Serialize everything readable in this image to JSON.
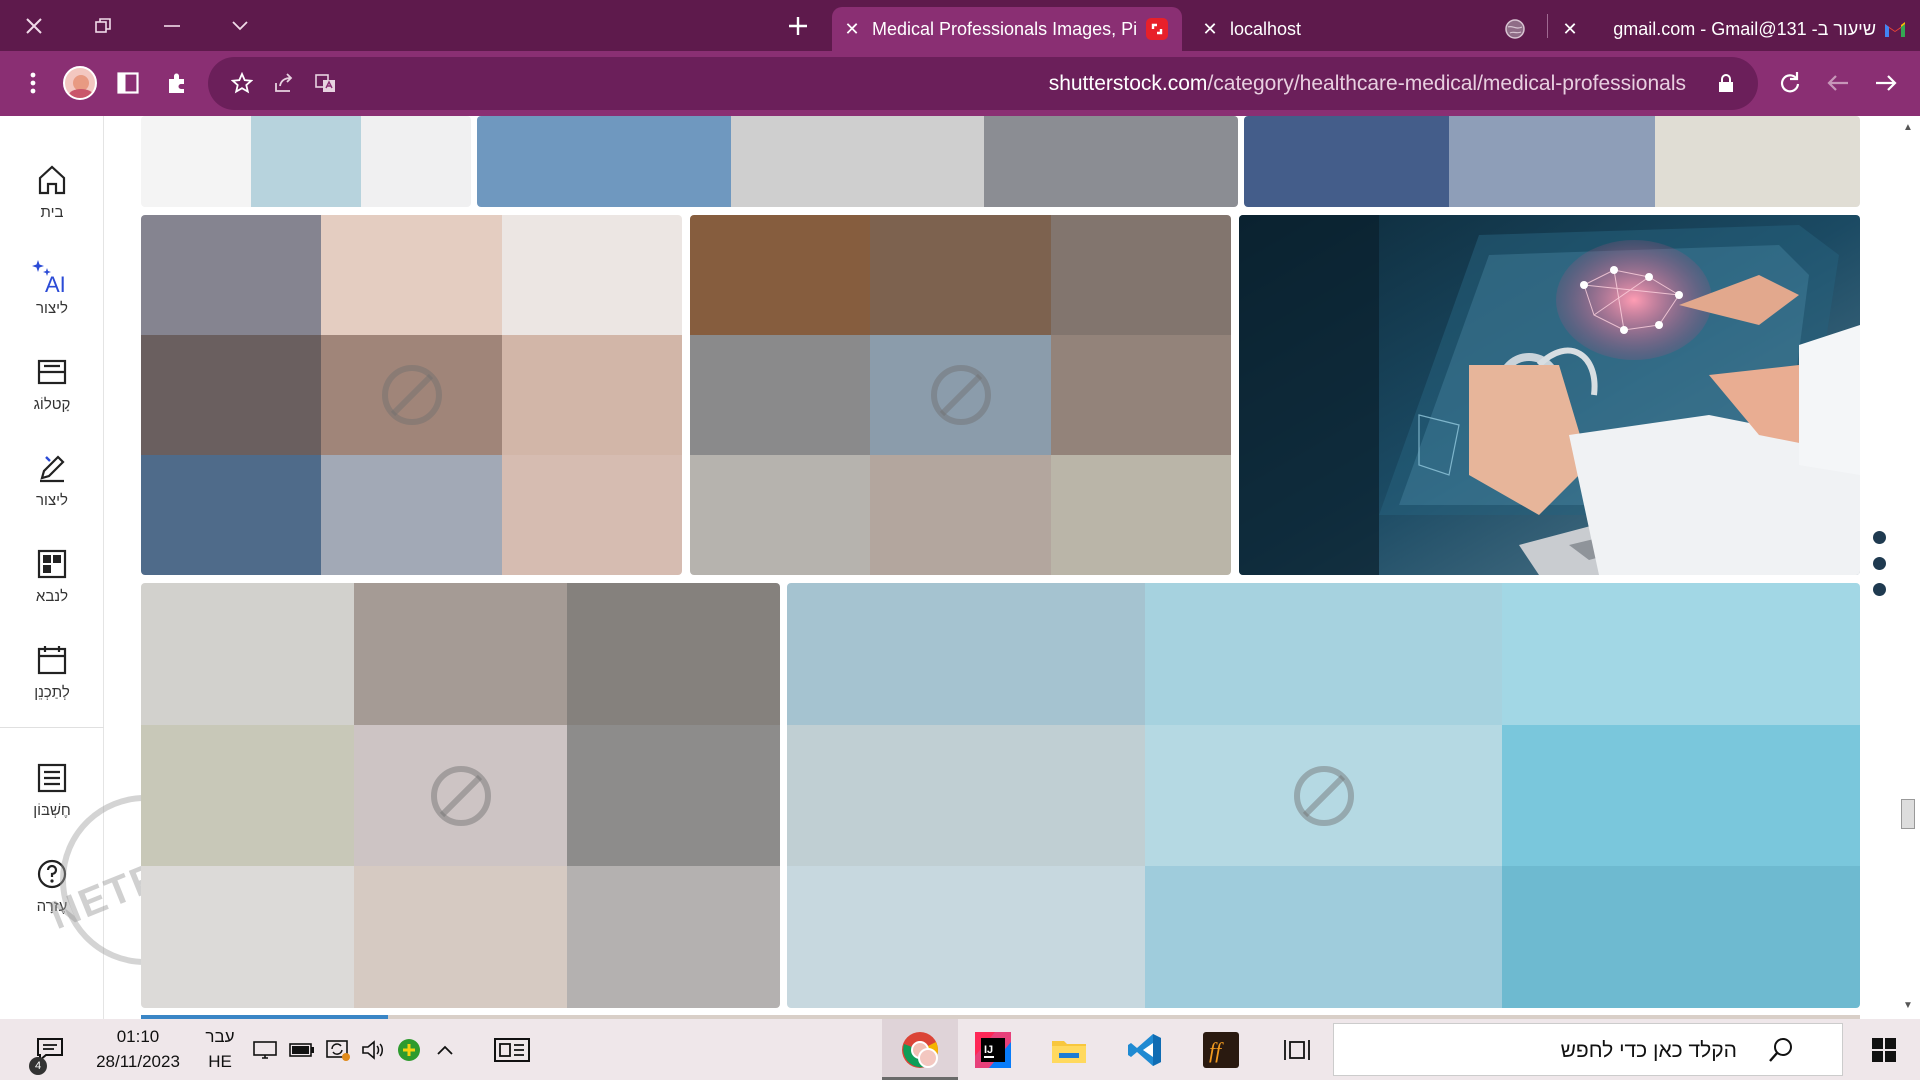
{
  "browser": {
    "tabs": [
      {
        "title": "Medical Professionals Images, Pi",
        "favicon": "shutterstock-icon",
        "active": true
      },
      {
        "title": "localhost",
        "favicon": "globe-icon",
        "active": false
      },
      {
        "title": "שיעור ב- 131@gmail.com - Gmail",
        "favicon": "gmail-icon",
        "active": false
      }
    ],
    "url_domain": "shutterstock.com",
    "url_path": "/category/healthcare-medical/medical-professionals",
    "colors": {
      "titlebar": "#5e1a4c",
      "toolbar": "#8a2f73",
      "active_tab": "#8a2f73"
    }
  },
  "sidenav": {
    "items": [
      {
        "label": "בית",
        "icon": "home-icon"
      },
      {
        "label": "ליצור",
        "icon": "ai-sparkle-icon"
      },
      {
        "label": "קָטלוֹג",
        "icon": "catalog-icon"
      },
      {
        "label": "ליצור",
        "icon": "edit-icon"
      },
      {
        "label": "לנבא",
        "icon": "dashboard-icon"
      },
      {
        "label": "לְתַכְנֵן",
        "icon": "calendar-icon"
      },
      {
        "label": "חֶשְׁבּוֹן",
        "icon": "list-icon"
      },
      {
        "label": "עֶזרָה",
        "icon": "help-icon"
      }
    ],
    "watermark": "NETFREE"
  },
  "content": {
    "blocked_icon": "blocked-image-icon",
    "tiles": [
      {
        "id": "top-left",
        "colors": [
          "#f4f4f4",
          "#b7d3dd",
          "#f0f0f1"
        ]
      },
      {
        "id": "top-mid",
        "colors": [
          "#6f98bf",
          "#cfcfcf",
          "#8b8d93"
        ]
      },
      {
        "id": "top-right",
        "colors": [
          "#445d8a",
          "#8e9eb8",
          "#e0ddd4"
        ]
      },
      {
        "id": "row2-a",
        "colors": [
          "#858490",
          "#e4cdc1",
          "#ece6e3",
          "#6a5f5f",
          "#a08579",
          "#d2b6a8",
          "#4f6b8a",
          "#a2a9b6",
          "#d6bcb1"
        ]
      },
      {
        "id": "row2-b",
        "colors": [
          "#865d3e",
          "#7d624f",
          "#82756e",
          "#8a8a8b",
          "#8b9cab",
          "#93837a",
          "#b6b3ae",
          "#b3a69e",
          "#bab5a8"
        ]
      },
      {
        "id": "row3-a",
        "colors": [
          "#d2d1cd",
          "#a59b95",
          "#85817d",
          "#c8c8b8",
          "#cdc4c4",
          "#8d8c8b",
          "#dcdad8",
          "#d6cac2",
          "#b4b1b0"
        ]
      },
      {
        "id": "row3-b",
        "colors": [
          "#a5c3d0",
          "#a6d2df",
          "#a2d7e5",
          "#c0cfd3",
          "#b5d9e3",
          "#7ac7dc",
          "#c7d8df",
          "#9fccdc",
          "#6ebad0"
        ]
      }
    ],
    "photo_alt": "doctor-laptop-brain-photo"
  },
  "taskbar": {
    "search_placeholder": "הקלד כאן כדי לחפש",
    "time": "01:10",
    "date": "28/11/2023",
    "lang_top": "עבר",
    "lang_bottom": "HE",
    "notifications": "4"
  }
}
